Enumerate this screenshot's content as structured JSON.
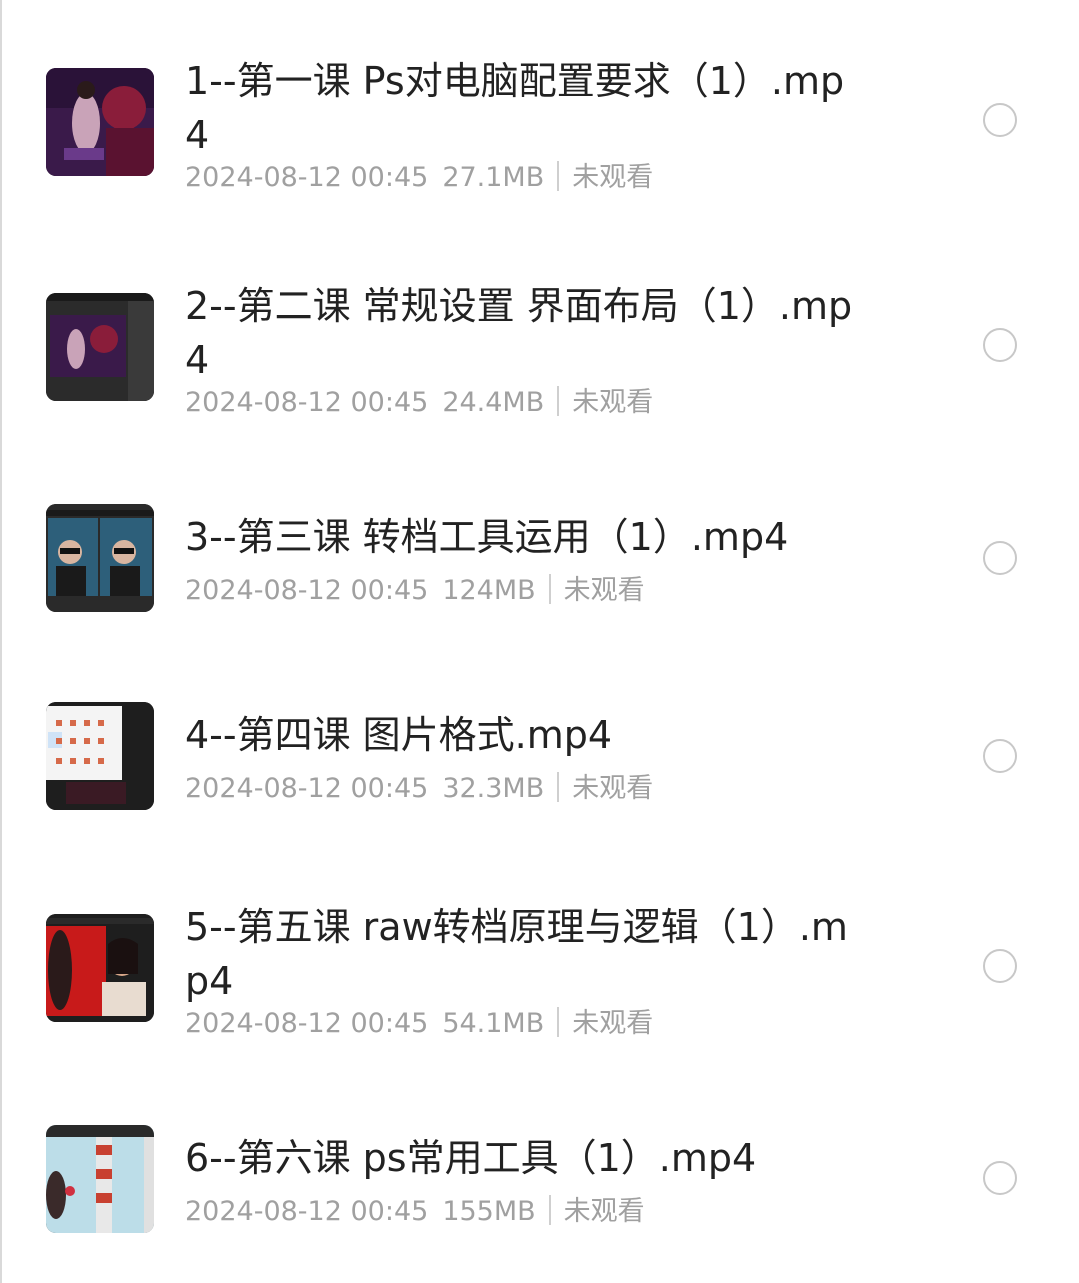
{
  "files": [
    {
      "title": "1--第一课 Ps对电脑配置要求（1）.mp4",
      "date": "2024-08-12 00:45",
      "size": "27.1MB",
      "status": "未观看"
    },
    {
      "title": "2--第二课 常规设置 界面布局（1）.mp4",
      "date": "2024-08-12 00:45",
      "size": "24.4MB",
      "status": "未观看"
    },
    {
      "title": "3--第三课 转档工具运用（1）.mp4",
      "date": "2024-08-12 00:45",
      "size": "124MB",
      "status": "未观看"
    },
    {
      "title": "4--第四课 图片格式.mp4",
      "date": "2024-08-12 00:45",
      "size": "32.3MB",
      "status": "未观看"
    },
    {
      "title": "5--第五课 raw转档原理与逻辑（1）.mp4",
      "date": "2024-08-12 00:45",
      "size": "54.1MB",
      "status": "未观看"
    },
    {
      "title": "6--第六课 ps常用工具（1）.mp4",
      "date": "2024-08-12 00:45",
      "size": "155MB",
      "status": "未观看"
    }
  ]
}
